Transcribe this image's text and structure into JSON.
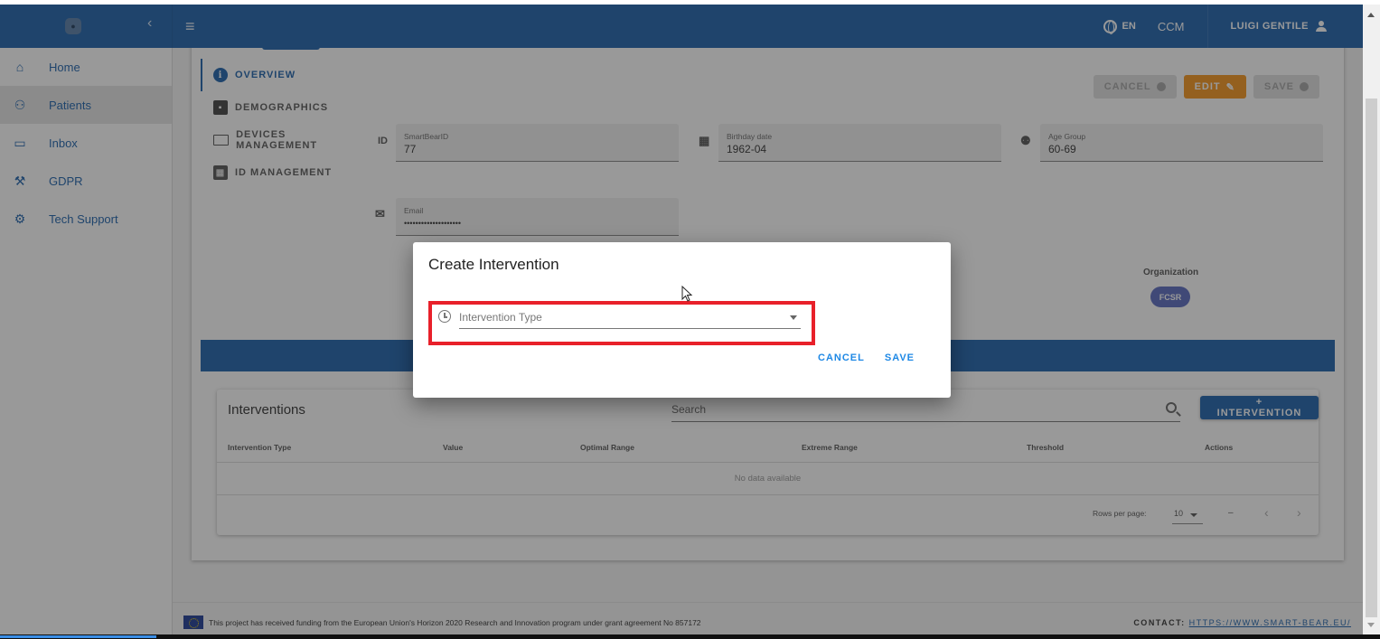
{
  "appbar": {
    "language": "EN",
    "role": "CCM",
    "user_name": "LUIGI GENTILE"
  },
  "sidebar": {
    "items": [
      {
        "label": "Home",
        "icon": "home-icon"
      },
      {
        "label": "Patients",
        "icon": "patients-icon",
        "active": true
      },
      {
        "label": "Inbox",
        "icon": "inbox-icon"
      },
      {
        "label": "GDPR",
        "icon": "gavel-icon"
      },
      {
        "label": "Tech Support",
        "icon": "support-icon"
      }
    ]
  },
  "tabs": [
    {
      "label": "OVERVIEW",
      "icon": "info-icon",
      "active": true
    },
    {
      "label": "DEMOGRAPHICS",
      "icon": "demographics-icon"
    },
    {
      "label": "DEVICES MANAGEMENT",
      "icon": "devices-icon"
    },
    {
      "label": "ID MANAGEMENT",
      "icon": "id-card-icon"
    }
  ],
  "actions": {
    "cancel": "CANCEL",
    "edit": "EDIT",
    "save": "SAVE"
  },
  "fields": {
    "smartbear_id": {
      "label": "SmartBearID",
      "value": "77",
      "icon_text": "ID"
    },
    "birthday": {
      "label": "Birthday date",
      "value": "1962-04"
    },
    "age_group": {
      "label": "Age Group",
      "value": "60-69"
    },
    "email": {
      "label": "Email",
      "value": "••••••••••••••••••••"
    }
  },
  "organization": {
    "label": "Organization",
    "value": "FCSR"
  },
  "interventions": {
    "title": "Interventions",
    "search_placeholder": "Search",
    "add_button": "+ INTERVENTION",
    "columns": [
      "Intervention Type",
      "Value",
      "Optimal Range",
      "Extreme Range",
      "Threshold",
      "Actions"
    ],
    "empty_text": "No data available",
    "rows_per_page_label": "Rows per page:",
    "rows_per_page": "10",
    "page_range": "–"
  },
  "footer": {
    "funding": "This project has received funding from the European Union's Horizon 2020 Research and Innovation program under grant agreement No 857172",
    "contact_label": "CONTACT:",
    "contact_link": "HTTPS://WWW.SMART-BEAR.EU/"
  },
  "dialog": {
    "title": "Create Intervention",
    "select_placeholder": "Intervention Type",
    "cancel": "CANCEL",
    "save": "SAVE",
    "highlight_color": "#e8202a"
  },
  "colors": {
    "primary": "#1e63ad",
    "edit": "#f5961e",
    "chip": "#5c6bc0"
  }
}
